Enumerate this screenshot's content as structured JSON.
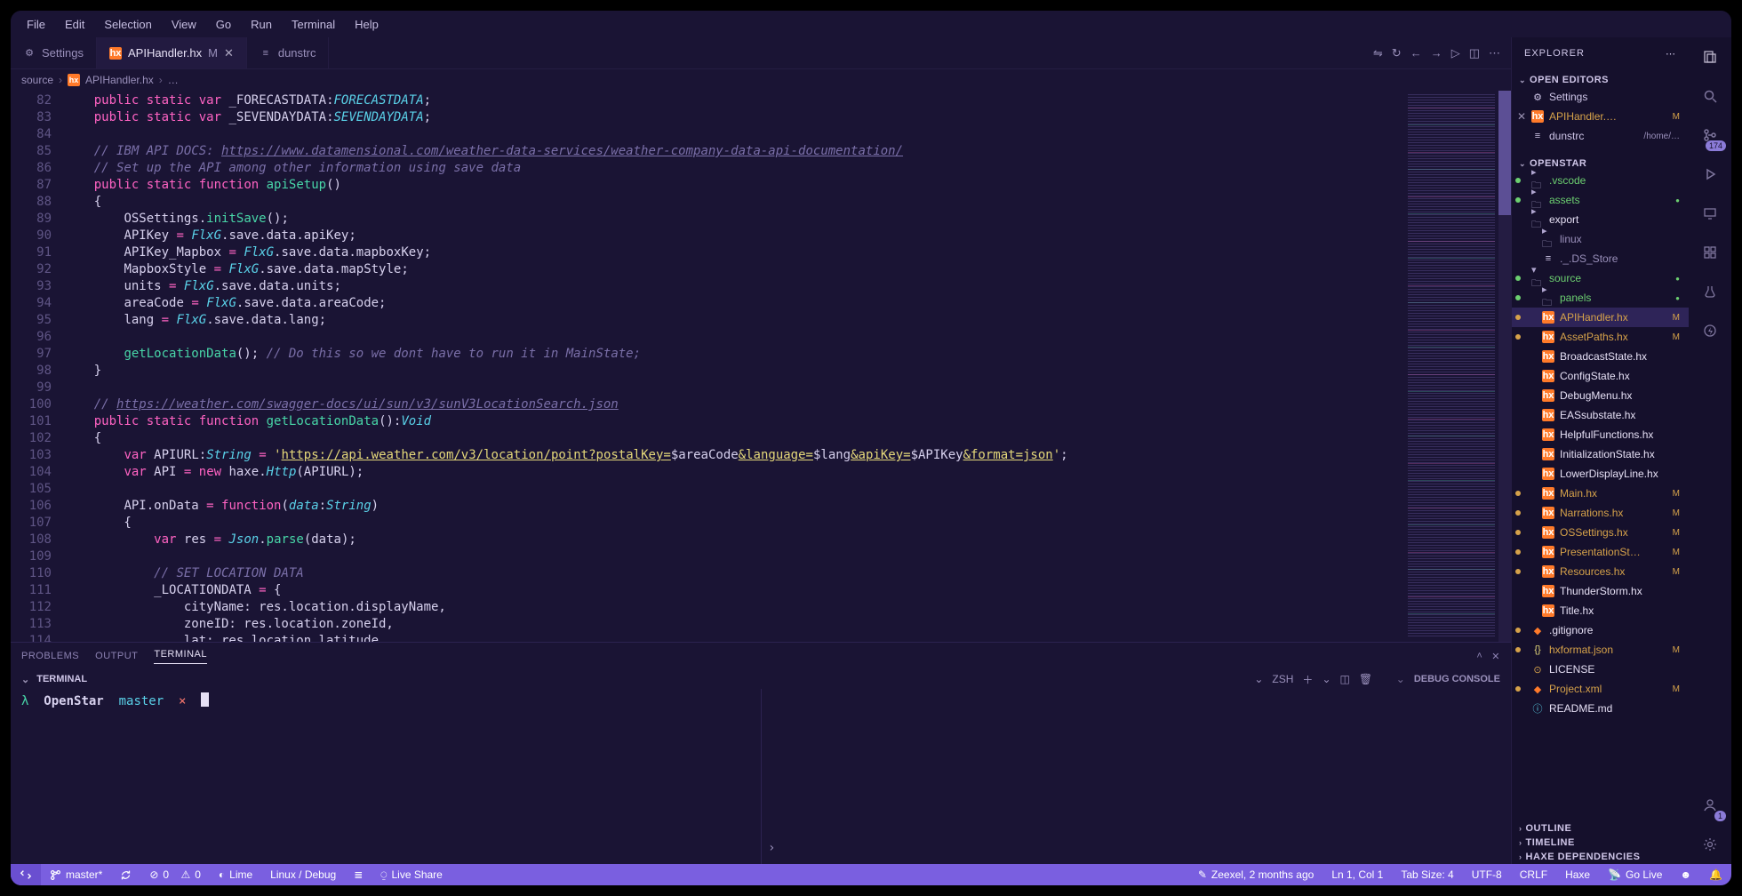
{
  "menu": [
    "File",
    "Edit",
    "Selection",
    "View",
    "Go",
    "Run",
    "Terminal",
    "Help"
  ],
  "tabs": [
    {
      "label": "Settings",
      "active": false,
      "modified": false,
      "closeable": false,
      "kind": "gear"
    },
    {
      "label": "APIHandler.hx",
      "active": true,
      "modified": true,
      "closeable": true,
      "kind": "hx",
      "suffix": "M"
    },
    {
      "label": "dunstrc",
      "active": false,
      "modified": false,
      "closeable": false,
      "kind": "file"
    }
  ],
  "breadcrumbs": {
    "a": "source",
    "b": "APIHandler.hx",
    "c": "…"
  },
  "lines": {
    "start": 82,
    "end": 114
  },
  "panel": {
    "tabs": [
      "PROBLEMS",
      "OUTPUT",
      "TERMINAL"
    ],
    "active": "TERMINAL",
    "title": "TERMINAL",
    "shell": "ZSH",
    "debug": "DEBUG CONSOLE",
    "termline": {
      "prompt": "λ",
      "cwd": "OpenStar",
      "branch": "master",
      "dirty": "×"
    }
  },
  "explorer": {
    "title": "EXPLORER",
    "openEditors": "OPEN EDITORS",
    "workspace": "OPENSTAR",
    "outline": "OUTLINE",
    "timeline": "TIMELINE",
    "haxe": "HAXE DEPENDENCIES",
    "editors": [
      {
        "label": "Settings",
        "kind": "gear"
      },
      {
        "label": "APIHandler.…",
        "kind": "hx",
        "suffix": "M",
        "close": true
      },
      {
        "label": "dunstrc",
        "kind": "file",
        "dim": "/home/…"
      }
    ],
    "tree": [
      {
        "label": ".vscode",
        "kind": "folder",
        "indent": 0,
        "scm": "green"
      },
      {
        "label": "assets",
        "kind": "folder",
        "indent": 0,
        "scm": "green",
        "dot": true
      },
      {
        "label": "export",
        "kind": "folder",
        "indent": 0
      },
      {
        "label": "linux",
        "kind": "folder",
        "indent": 1,
        "dim": true
      },
      {
        "label": "._.DS_Store",
        "kind": "file",
        "indent": 1,
        "dim": true
      },
      {
        "label": "source",
        "kind": "folder",
        "indent": 0,
        "scm": "green",
        "open": true,
        "dot": true
      },
      {
        "label": "panels",
        "kind": "folder",
        "indent": 1,
        "scm": "green",
        "dot": true
      },
      {
        "label": "APIHandler.hx",
        "kind": "hx",
        "indent": 1,
        "suffix": "M",
        "sel": true,
        "scm": "orange"
      },
      {
        "label": "AssetPaths.hx",
        "kind": "hx",
        "indent": 1,
        "suffix": "M",
        "scm": "orange"
      },
      {
        "label": "BroadcastState.hx",
        "kind": "hx",
        "indent": 1
      },
      {
        "label": "ConfigState.hx",
        "kind": "hx",
        "indent": 1
      },
      {
        "label": "DebugMenu.hx",
        "kind": "hx",
        "indent": 1
      },
      {
        "label": "EASsubstate.hx",
        "kind": "hx",
        "indent": 1
      },
      {
        "label": "HelpfulFunctions.hx",
        "kind": "hx",
        "indent": 1
      },
      {
        "label": "InitializationState.hx",
        "kind": "hx",
        "indent": 1
      },
      {
        "label": "LowerDisplayLine.hx",
        "kind": "hx",
        "indent": 1
      },
      {
        "label": "Main.hx",
        "kind": "hx",
        "indent": 1,
        "suffix": "M",
        "scm": "orange"
      },
      {
        "label": "Narrations.hx",
        "kind": "hx",
        "indent": 1,
        "suffix": "M",
        "scm": "orange"
      },
      {
        "label": "OSSettings.hx",
        "kind": "hx",
        "indent": 1,
        "suffix": "M",
        "scm": "orange"
      },
      {
        "label": "PresentationSt…",
        "kind": "hx",
        "indent": 1,
        "suffix": "M",
        "scm": "orange"
      },
      {
        "label": "Resources.hx",
        "kind": "hx",
        "indent": 1,
        "suffix": "M",
        "scm": "orange"
      },
      {
        "label": "ThunderStorm.hx",
        "kind": "hx",
        "indent": 1
      },
      {
        "label": "Title.hx",
        "kind": "hx",
        "indent": 1
      },
      {
        "label": ".gitignore",
        "kind": "git",
        "indent": 0,
        "scm": "orange"
      },
      {
        "label": "hxformat.json",
        "kind": "json",
        "indent": 0,
        "suffix": "M",
        "scm": "orange"
      },
      {
        "label": "LICENSE",
        "kind": "lic",
        "indent": 0
      },
      {
        "label": "Project.xml",
        "kind": "xml",
        "indent": 0,
        "suffix": "M",
        "scm": "orange"
      },
      {
        "label": "README.md",
        "kind": "md",
        "indent": 0
      }
    ]
  },
  "activity": {
    "scmBadge": "174",
    "accountBadge": "1"
  },
  "status": {
    "branch": "master*",
    "errors": "0",
    "warnings": "0",
    "lime": "Lime",
    "target": "Linux / Debug",
    "live": "Live Share",
    "blame": "Zeexel, 2 months ago",
    "pos": "Ln 1, Col 1",
    "tab": "Tab Size: 4",
    "enc": "UTF-8",
    "eol": "CRLF",
    "lang": "Haxe",
    "golive": "Go Live"
  }
}
